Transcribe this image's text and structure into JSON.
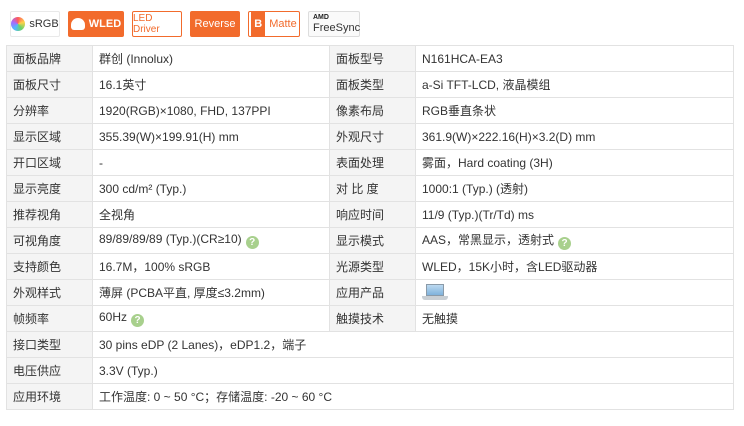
{
  "badges": {
    "srgb": "sRGB",
    "wled": "WLED",
    "led_driver": "LED Driver",
    "reverse": "Reverse",
    "matte": "Matte",
    "matte_letter": "B",
    "freesync_brand": "AMD",
    "freesync": "FreeSync"
  },
  "rows": [
    {
      "k1": "面板品牌",
      "v1": "群创 (Innolux)",
      "k2": "面板型号",
      "v2": "N161HCA-EA3"
    },
    {
      "k1": "面板尺寸",
      "v1": "16.1英寸",
      "k2": "面板类型",
      "v2": "a-Si TFT-LCD, 液晶模组"
    },
    {
      "k1": "分辨率",
      "v1": "1920(RGB)×1080, FHD, 137PPI",
      "k2": "像素布局",
      "v2": "RGB垂直条状"
    },
    {
      "k1": "显示区域",
      "v1": "355.39(W)×199.91(H) mm",
      "k2": "外观尺寸",
      "v2": "361.9(W)×222.16(H)×3.2(D) mm"
    },
    {
      "k1": "开口区域",
      "v1": "-",
      "k2": "表面处理",
      "v2": "雾面，Hard coating (3H)"
    },
    {
      "k1": "显示亮度",
      "v1": "300 cd/m² (Typ.)",
      "k2": "对 比 度",
      "v2": "1000:1 (Typ.) (透射)"
    },
    {
      "k1": "推荐视角",
      "v1": "全视角",
      "k2": "响应时间",
      "v2": "11/9 (Typ.)(Tr/Td) ms"
    },
    {
      "k1": "可视角度",
      "v1": "89/89/89/89 (Typ.)(CR≥10)",
      "k2": "显示模式",
      "v2": "AAS，常黑显示，透射式"
    },
    {
      "k1": "支持颜色",
      "v1": "16.7M，100% sRGB",
      "k2": "光源类型",
      "v2": "WLED，15K小时，含LED驱动器"
    },
    {
      "k1": "外观样式",
      "v1": "薄屏 (PCBA平直, 厚度≤3.2mm)",
      "k2": "应用产品",
      "v2": ""
    },
    {
      "k1": "帧频率",
      "v1": "60Hz",
      "k2": "触摸技术",
      "v2": "无触摸"
    }
  ],
  "wide_rows": [
    {
      "k": "接口类型",
      "v": "30 pins   eDP (2 Lanes)，eDP1.2，端子"
    },
    {
      "k": "电压供应",
      "v": "3.3V (Typ.)"
    },
    {
      "k": "应用环境",
      "v": "工作温度: 0 ~ 50 °C；存储温度: -20 ~ 60 °C"
    }
  ],
  "help_glyph": "?"
}
